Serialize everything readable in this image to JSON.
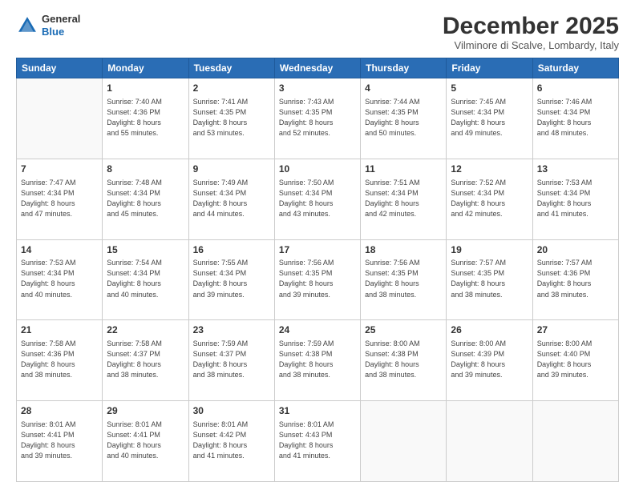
{
  "header": {
    "logo": {
      "general": "General",
      "blue": "Blue"
    },
    "title": "December 2025",
    "location": "Vilminore di Scalve, Lombardy, Italy"
  },
  "weekdays": [
    "Sunday",
    "Monday",
    "Tuesday",
    "Wednesday",
    "Thursday",
    "Friday",
    "Saturday"
  ],
  "weeks": [
    [
      {
        "day": "",
        "info": ""
      },
      {
        "day": "1",
        "info": "Sunrise: 7:40 AM\nSunset: 4:36 PM\nDaylight: 8 hours\nand 55 minutes."
      },
      {
        "day": "2",
        "info": "Sunrise: 7:41 AM\nSunset: 4:35 PM\nDaylight: 8 hours\nand 53 minutes."
      },
      {
        "day": "3",
        "info": "Sunrise: 7:43 AM\nSunset: 4:35 PM\nDaylight: 8 hours\nand 52 minutes."
      },
      {
        "day": "4",
        "info": "Sunrise: 7:44 AM\nSunset: 4:35 PM\nDaylight: 8 hours\nand 50 minutes."
      },
      {
        "day": "5",
        "info": "Sunrise: 7:45 AM\nSunset: 4:34 PM\nDaylight: 8 hours\nand 49 minutes."
      },
      {
        "day": "6",
        "info": "Sunrise: 7:46 AM\nSunset: 4:34 PM\nDaylight: 8 hours\nand 48 minutes."
      }
    ],
    [
      {
        "day": "7",
        "info": "Sunrise: 7:47 AM\nSunset: 4:34 PM\nDaylight: 8 hours\nand 47 minutes."
      },
      {
        "day": "8",
        "info": "Sunrise: 7:48 AM\nSunset: 4:34 PM\nDaylight: 8 hours\nand 45 minutes."
      },
      {
        "day": "9",
        "info": "Sunrise: 7:49 AM\nSunset: 4:34 PM\nDaylight: 8 hours\nand 44 minutes."
      },
      {
        "day": "10",
        "info": "Sunrise: 7:50 AM\nSunset: 4:34 PM\nDaylight: 8 hours\nand 43 minutes."
      },
      {
        "day": "11",
        "info": "Sunrise: 7:51 AM\nSunset: 4:34 PM\nDaylight: 8 hours\nand 42 minutes."
      },
      {
        "day": "12",
        "info": "Sunrise: 7:52 AM\nSunset: 4:34 PM\nDaylight: 8 hours\nand 42 minutes."
      },
      {
        "day": "13",
        "info": "Sunrise: 7:53 AM\nSunset: 4:34 PM\nDaylight: 8 hours\nand 41 minutes."
      }
    ],
    [
      {
        "day": "14",
        "info": "Sunrise: 7:53 AM\nSunset: 4:34 PM\nDaylight: 8 hours\nand 40 minutes."
      },
      {
        "day": "15",
        "info": "Sunrise: 7:54 AM\nSunset: 4:34 PM\nDaylight: 8 hours\nand 40 minutes."
      },
      {
        "day": "16",
        "info": "Sunrise: 7:55 AM\nSunset: 4:34 PM\nDaylight: 8 hours\nand 39 minutes."
      },
      {
        "day": "17",
        "info": "Sunrise: 7:56 AM\nSunset: 4:35 PM\nDaylight: 8 hours\nand 39 minutes."
      },
      {
        "day": "18",
        "info": "Sunrise: 7:56 AM\nSunset: 4:35 PM\nDaylight: 8 hours\nand 38 minutes."
      },
      {
        "day": "19",
        "info": "Sunrise: 7:57 AM\nSunset: 4:35 PM\nDaylight: 8 hours\nand 38 minutes."
      },
      {
        "day": "20",
        "info": "Sunrise: 7:57 AM\nSunset: 4:36 PM\nDaylight: 8 hours\nand 38 minutes."
      }
    ],
    [
      {
        "day": "21",
        "info": "Sunrise: 7:58 AM\nSunset: 4:36 PM\nDaylight: 8 hours\nand 38 minutes."
      },
      {
        "day": "22",
        "info": "Sunrise: 7:58 AM\nSunset: 4:37 PM\nDaylight: 8 hours\nand 38 minutes."
      },
      {
        "day": "23",
        "info": "Sunrise: 7:59 AM\nSunset: 4:37 PM\nDaylight: 8 hours\nand 38 minutes."
      },
      {
        "day": "24",
        "info": "Sunrise: 7:59 AM\nSunset: 4:38 PM\nDaylight: 8 hours\nand 38 minutes."
      },
      {
        "day": "25",
        "info": "Sunrise: 8:00 AM\nSunset: 4:38 PM\nDaylight: 8 hours\nand 38 minutes."
      },
      {
        "day": "26",
        "info": "Sunrise: 8:00 AM\nSunset: 4:39 PM\nDaylight: 8 hours\nand 39 minutes."
      },
      {
        "day": "27",
        "info": "Sunrise: 8:00 AM\nSunset: 4:40 PM\nDaylight: 8 hours\nand 39 minutes."
      }
    ],
    [
      {
        "day": "28",
        "info": "Sunrise: 8:01 AM\nSunset: 4:41 PM\nDaylight: 8 hours\nand 39 minutes."
      },
      {
        "day": "29",
        "info": "Sunrise: 8:01 AM\nSunset: 4:41 PM\nDaylight: 8 hours\nand 40 minutes."
      },
      {
        "day": "30",
        "info": "Sunrise: 8:01 AM\nSunset: 4:42 PM\nDaylight: 8 hours\nand 41 minutes."
      },
      {
        "day": "31",
        "info": "Sunrise: 8:01 AM\nSunset: 4:43 PM\nDaylight: 8 hours\nand 41 minutes."
      },
      {
        "day": "",
        "info": ""
      },
      {
        "day": "",
        "info": ""
      },
      {
        "day": "",
        "info": ""
      }
    ]
  ]
}
